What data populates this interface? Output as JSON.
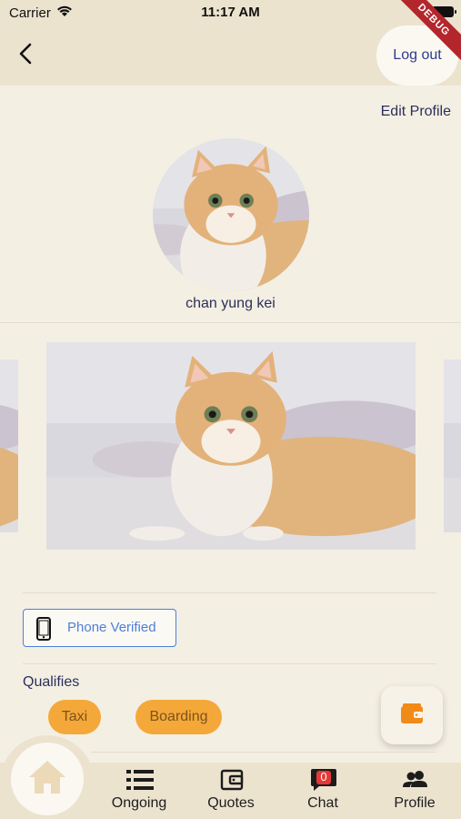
{
  "status_bar": {
    "carrier": "Carrier",
    "time": "11:17 AM"
  },
  "debug_banner": "DEBUG",
  "header": {
    "logout_label": "Log out"
  },
  "profile": {
    "edit_label": "Edit Profile",
    "username": "chan yung kei"
  },
  "verification": {
    "label": "Phone Verified"
  },
  "qualifies": {
    "title": "Qualifies",
    "chips": [
      "Taxi",
      "Boarding"
    ]
  },
  "bottom_nav": {
    "items": [
      {
        "label": "Ongoing",
        "icon": "list-icon"
      },
      {
        "label": "Quotes",
        "icon": "wallet-icon"
      },
      {
        "label": "Chat",
        "icon": "chat-icon",
        "badge": "0"
      },
      {
        "label": "Profile",
        "icon": "people-icon"
      }
    ]
  },
  "colors": {
    "accent": "#f5a83a",
    "header_bg": "#ece3cf",
    "page_bg": "#f4efe3",
    "verified_blue": "#4e7fd8",
    "badge_red": "#e53935"
  }
}
